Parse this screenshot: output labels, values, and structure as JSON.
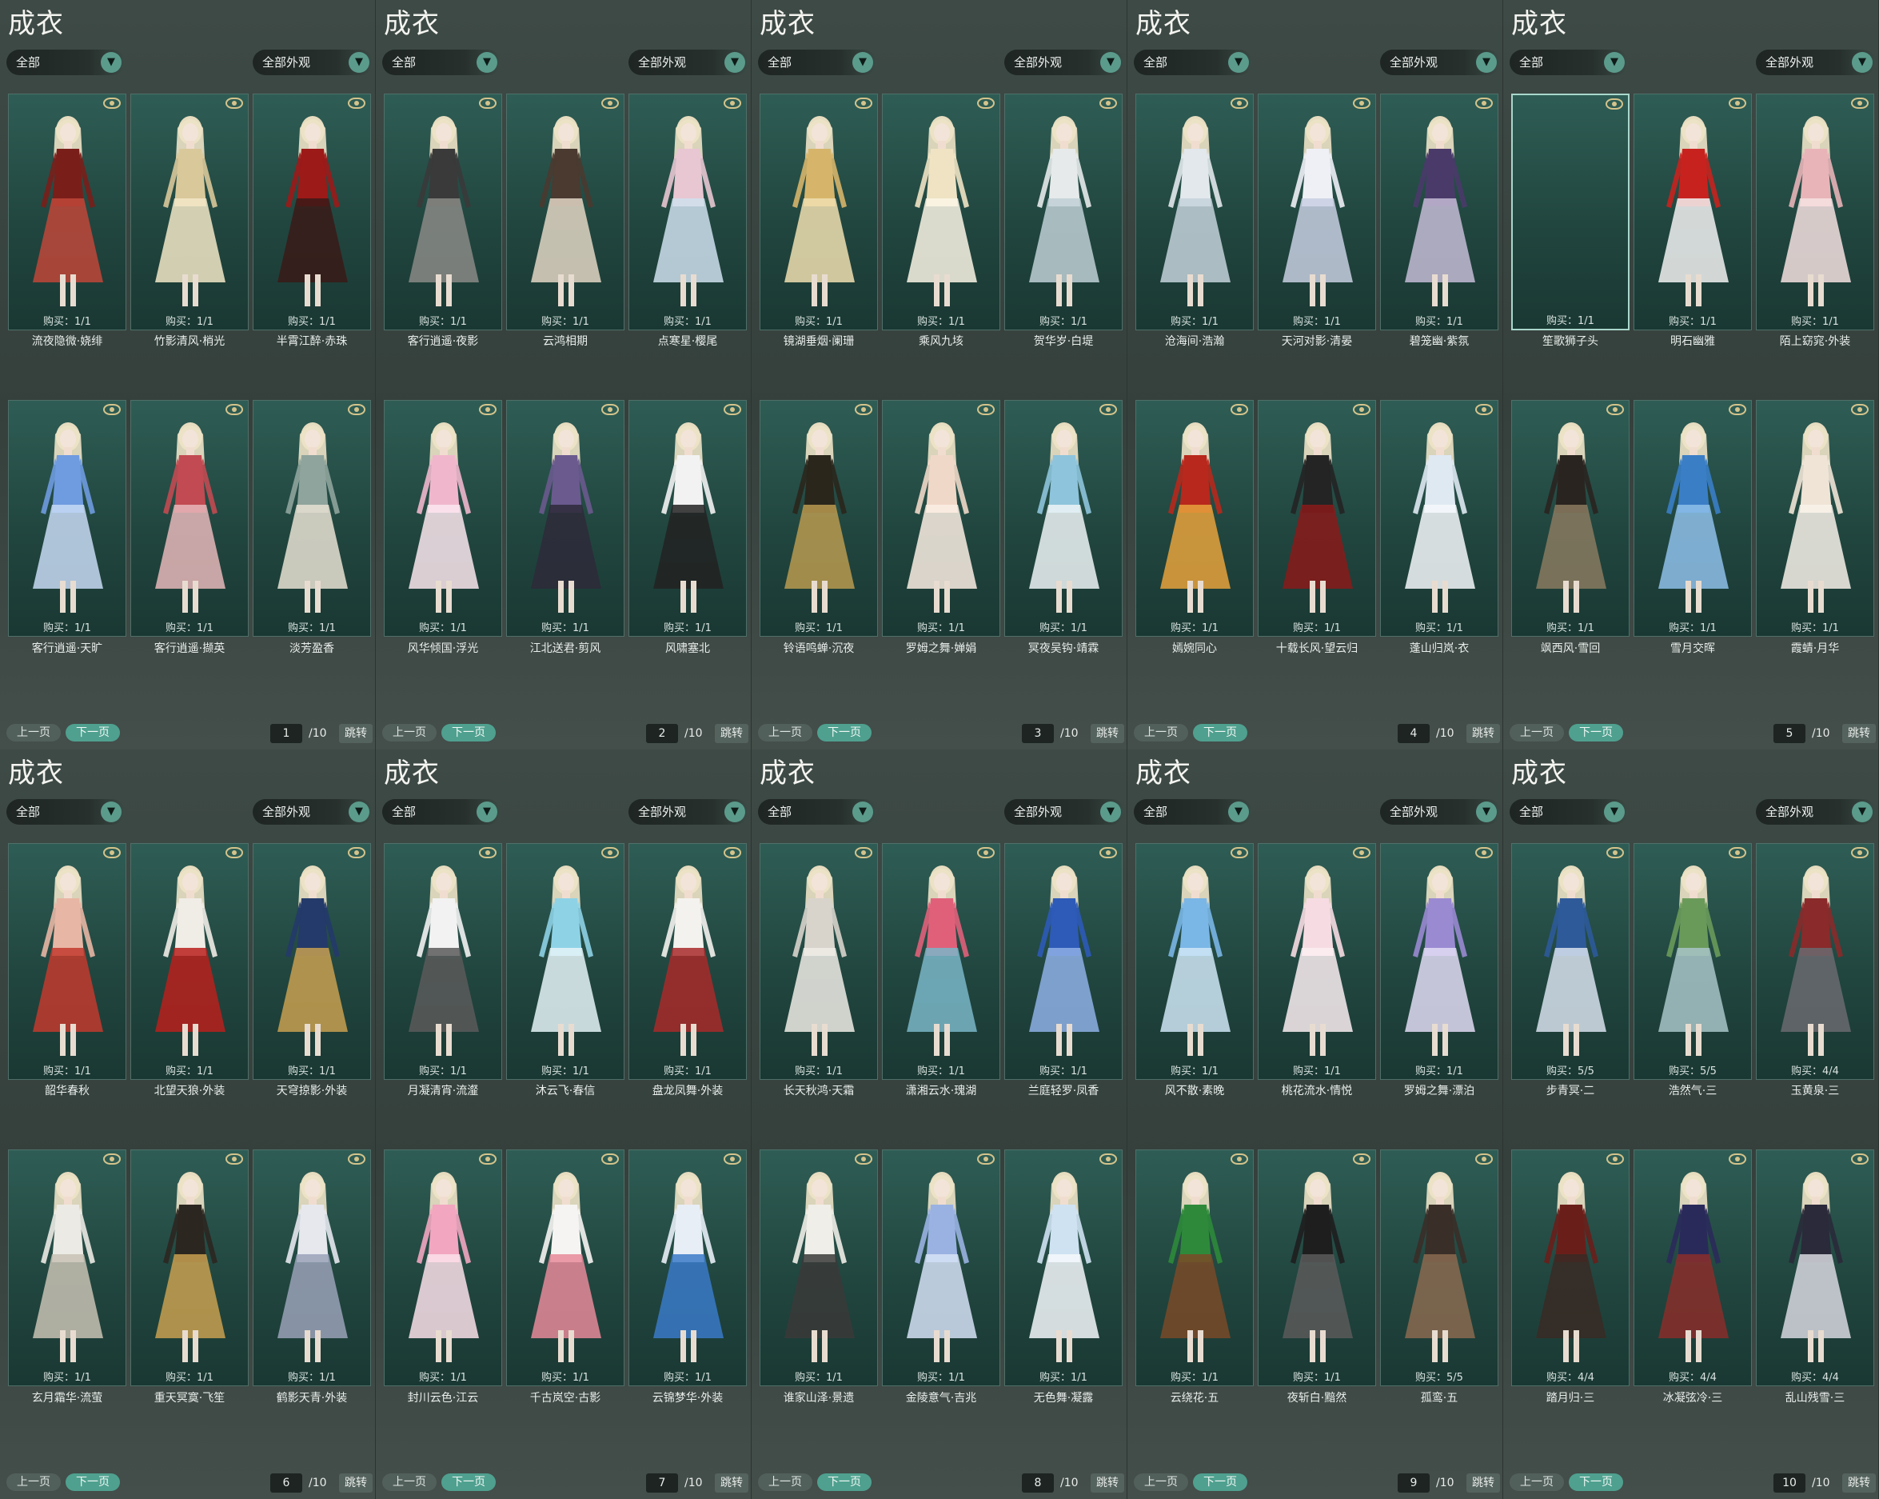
{
  "common": {
    "title": "成衣",
    "filter_category": "全部",
    "filter_appearance": "全部外观",
    "prev_label": "上一页",
    "next_label": "下一页",
    "total_pages": "/10",
    "jump_label": "跳转"
  },
  "pages": [
    {
      "page": "1",
      "items": [
        {
          "name": "流夜隐微·娆绯",
          "buy": "购买：1/1",
          "colors": [
            "#7a1e1a",
            "#c0463a"
          ]
        },
        {
          "name": "竹影清风·梢光",
          "buy": "购买：1/1",
          "colors": [
            "#d9c89a",
            "#f2e8c8"
          ]
        },
        {
          "name": "半霄江醉·赤珠",
          "buy": "购买：1/1",
          "colors": [
            "#9c1a18",
            "#3a1a18"
          ]
        },
        {
          "name": "客行逍遥·天旷",
          "buy": "购买：1/1",
          "colors": [
            "#6f9be0",
            "#c8dbf5"
          ]
        },
        {
          "name": "客行逍遥·撷英",
          "buy": "购买：1/1",
          "colors": [
            "#c24a52",
            "#e6b7ba"
          ]
        },
        {
          "name": "淡芳盈香",
          "buy": "购买：1/1",
          "colors": [
            "#8fa49c",
            "#e8e2d4"
          ]
        }
      ]
    },
    {
      "page": "2",
      "items": [
        {
          "name": "客行逍遥·夜影",
          "buy": "购买：1/1",
          "colors": [
            "#3a3a3a",
            "#8a8a86"
          ]
        },
        {
          "name": "云鸿相期",
          "buy": "购买：1/1",
          "colors": [
            "#4a3a30",
            "#e2d6c4"
          ]
        },
        {
          "name": "点寒星·樱尾",
          "buy": "购买：1/1",
          "colors": [
            "#e8c6d2",
            "#cfe0ee"
          ]
        },
        {
          "name": "风华倾国·浮光",
          "buy": "购买：1/1",
          "colors": [
            "#f0b7cc",
            "#fbe7ee"
          ]
        },
        {
          "name": "江北送君·剪风",
          "buy": "购买：1/1",
          "colors": [
            "#6a5a8e",
            "#2e2a3a"
          ]
        },
        {
          "name": "风啸塞北",
          "buy": "购买：1/1",
          "colors": [
            "#f2f2f2",
            "#222222"
          ]
        }
      ]
    },
    {
      "page": "3",
      "items": [
        {
          "name": "镜湖垂烟·阑珊",
          "buy": "购买：1/1",
          "colors": [
            "#d6b56a",
            "#f0dfb0"
          ]
        },
        {
          "name": "乘风九垓",
          "buy": "购买：1/1",
          "colors": [
            "#efe3c4",
            "#fbf6e6"
          ]
        },
        {
          "name": "贺华岁·白堤",
          "buy": "购买：1/1",
          "colors": [
            "#e6eaea",
            "#bfd0d6"
          ]
        },
        {
          "name": "铃语鸣蝉·沉夜",
          "buy": "购买：1/1",
          "colors": [
            "#2a261c",
            "#b89a50"
          ]
        },
        {
          "name": "罗姆之舞·婵娟",
          "buy": "购买：1/1",
          "colors": [
            "#f0d8c8",
            "#fbeee4"
          ]
        },
        {
          "name": "冥夜吴钩·靖霖",
          "buy": "购买：1/1",
          "colors": [
            "#8ec4dc",
            "#eef4f6"
          ]
        }
      ]
    },
    {
      "page": "4",
      "items": [
        {
          "name": "沧海间·浩瀚",
          "buy": "购买：1/1",
          "colors": [
            "#e2e8ec",
            "#c4d2da"
          ]
        },
        {
          "name": "天河对影·清晏",
          "buy": "购买：1/1",
          "colors": [
            "#eef0f6",
            "#c8cfe2"
          ]
        },
        {
          "name": "碧笼幽·紫氛",
          "buy": "购买：1/1",
          "colors": [
            "#4a3a6a",
            "#c4bcd6"
          ]
        },
        {
          "name": "嫣婉同心",
          "buy": "购买：1/1",
          "colors": [
            "#b8281c",
            "#e6a23c"
          ]
        },
        {
          "name": "十载长风·望云归",
          "buy": "购买：1/1",
          "colors": [
            "#242424",
            "#8a1a1a"
          ]
        },
        {
          "name": "蓬山归岚·衣",
          "buy": "购买：1/1",
          "colors": [
            "#dfe9f2",
            "#f6f8fb"
          ]
        }
      ]
    },
    {
      "page": "5",
      "items": [
        {
          "name": "笙歌狮子头",
          "buy": "购买：1/1",
          "colors": [
            "#2f5e56",
            "#2f5e56"
          ],
          "empty": true,
          "selected": true
        },
        {
          "name": "明石幽雅",
          "buy": "购买：1/1",
          "colors": [
            "#c8221e",
            "#f2f2f2"
          ]
        },
        {
          "name": "陌上窈窕·外装",
          "buy": "购买：1/1",
          "colors": [
            "#e8b4b8",
            "#f6e2e2"
          ]
        },
        {
          "name": "飒西风·雪回",
          "buy": "购买：1/1",
          "colors": [
            "#2a2420",
            "#8a7a60"
          ]
        },
        {
          "name": "雪月交晖",
          "buy": "购买：1/1",
          "colors": [
            "#3a7ec6",
            "#8ec0ea"
          ]
        },
        {
          "name": "霞蜻·月华",
          "buy": "购买：1/1",
          "colors": [
            "#efe4d6",
            "#f8f2ea"
          ]
        }
      ]
    },
    {
      "page": "6",
      "items": [
        {
          "name": "韶华春秋",
          "buy": "购买：1/1",
          "colors": [
            "#e8b6a4",
            "#c23a2e"
          ]
        },
        {
          "name": "北望天狼·外装",
          "buy": "购买：1/1",
          "colors": [
            "#f0ece6",
            "#b8201c"
          ]
        },
        {
          "name": "天穹掠影·外装",
          "buy": "购买：1/1",
          "colors": [
            "#243a6a",
            "#c8a050"
          ]
        },
        {
          "name": "玄月霜华·流萤",
          "buy": "购买：1/1",
          "colors": [
            "#eceae4",
            "#c8c2b4"
          ]
        },
        {
          "name": "重天冥寞·飞笙",
          "buy": "购买：1/1",
          "colors": [
            "#2c2620",
            "#c8a050"
          ]
        },
        {
          "name": "鹤影天青·外装",
          "buy": "购买：1/1",
          "colors": [
            "#e6e8ee",
            "#9aa2b8"
          ]
        }
      ]
    },
    {
      "page": "7",
      "items": [
        {
          "name": "月凝清宵·流瀣",
          "buy": "购买：1/1",
          "colors": [
            "#f2f2f2",
            "#5a5a5a"
          ]
        },
        {
          "name": "沐云飞·春信",
          "buy": "购买：1/1",
          "colors": [
            "#8ed2e6",
            "#e6f4f8"
          ]
        },
        {
          "name": "盘龙凤舞·外装",
          "buy": "购买：1/1",
          "colors": [
            "#f4f2ee",
            "#a82a2a"
          ]
        },
        {
          "name": "封川云色·江云",
          "buy": "购买：1/1",
          "colors": [
            "#f2a6c0",
            "#fbe0ea"
          ]
        },
        {
          "name": "千古岚空·古影",
          "buy": "购买：1/1",
          "colors": [
            "#f6f4f2",
            "#e88a9a"
          ]
        },
        {
          "name": "云锦梦华·外装",
          "buy": "购买：1/1",
          "colors": [
            "#e8eef6",
            "#3a7ac8"
          ]
        }
      ]
    },
    {
      "page": "8",
      "items": [
        {
          "name": "长天秋鸿·天霜",
          "buy": "购买：1/1",
          "colors": [
            "#d8d4cc",
            "#f0ece6"
          ]
        },
        {
          "name": "潇湘云水·瑰湖",
          "buy": "购买：1/1",
          "colors": [
            "#e0607a",
            "#7ab6c8"
          ]
        },
        {
          "name": "兰庭轻罗·凤香",
          "buy": "购买：1/1",
          "colors": [
            "#2e5ab8",
            "#8eb0e6"
          ]
        },
        {
          "name": "谁家山泽·景遗",
          "buy": "购买：1/1",
          "colors": [
            "#f0eee8",
            "#3a3a38"
          ]
        },
        {
          "name": "金陵意气·吉兆",
          "buy": "购买：1/1",
          "colors": [
            "#9ab2e2",
            "#d6e2f6"
          ]
        },
        {
          "name": "无色舞·凝露",
          "buy": "购买：1/1",
          "colors": [
            "#cfe2f2",
            "#f4f8fc"
          ]
        }
      ]
    },
    {
      "page": "9",
      "items": [
        {
          "name": "风不散·素晚",
          "buy": "购买：1/1",
          "colors": [
            "#7ab6e6",
            "#cfe6f6"
          ]
        },
        {
          "name": "桃花流水·情悦",
          "buy": "购买：1/1",
          "colors": [
            "#f6dce2",
            "#fbeff2"
          ]
        },
        {
          "name": "罗姆之舞·漂泊",
          "buy": "购买：1/1",
          "colors": [
            "#9a8ad2",
            "#e2dcf4"
          ]
        },
        {
          "name": "云绕花·五",
          "buy": "购买：1/1",
          "colors": [
            "#2e8a3a",
            "#7a4a28"
          ]
        },
        {
          "name": "夜斩白·黯然",
          "buy": "购买：1/1",
          "colors": [
            "#1e1e1e",
            "#5a5a5a"
          ]
        },
        {
          "name": "孤鸾·五",
          "buy": "购买：5/5",
          "colors": [
            "#3a2e28",
            "#8a6a50"
          ]
        }
      ]
    },
    {
      "page": "10",
      "items": [
        {
          "name": "步青冥·二",
          "buy": "购买：5/5",
          "colors": [
            "#2e5a9a",
            "#d8e2ee"
          ]
        },
        {
          "name": "浩然气·三",
          "buy": "购买：5/5",
          "colors": [
            "#6a9a5a",
            "#a8c4c8"
          ]
        },
        {
          "name": "玉黄泉·三",
          "buy": "购买：4/4",
          "colors": [
            "#8a2a2a",
            "#6a6a70"
          ]
        },
        {
          "name": "踏月归·三",
          "buy": "购买：4/4",
          "colors": [
            "#6a1e1a",
            "#3a2a24"
          ]
        },
        {
          "name": "冰凝弦冷·三",
          "buy": "购买：4/4",
          "colors": [
            "#2a2a5a",
            "#8a2e2a"
          ]
        },
        {
          "name": "乱山残雪·三",
          "buy": "购买：4/4",
          "colors": [
            "#2a2a3a",
            "#d8d8e0"
          ]
        }
      ]
    }
  ]
}
